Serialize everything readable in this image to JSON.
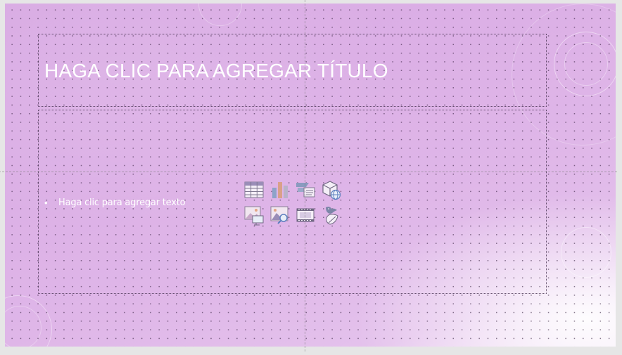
{
  "slide": {
    "title_placeholder": "HAGA CLIC PARA AGREGAR TÍTULO",
    "content_bullet": "•",
    "content_placeholder": "Haga clic para agregar texto"
  },
  "content_icons": [
    {
      "name": "insert-table-icon"
    },
    {
      "name": "insert-chart-icon"
    },
    {
      "name": "insert-smartart-icon"
    },
    {
      "name": "insert-3d-model-icon"
    },
    {
      "name": "insert-picture-icon"
    },
    {
      "name": "insert-online-picture-icon"
    },
    {
      "name": "insert-video-icon"
    },
    {
      "name": "insert-icons-icon"
    }
  ],
  "colors": {
    "background_start": "#d8a9e3",
    "background_end": "#f1dff5",
    "text": "#ffffff",
    "icon_accent": "#8a7bb8"
  }
}
